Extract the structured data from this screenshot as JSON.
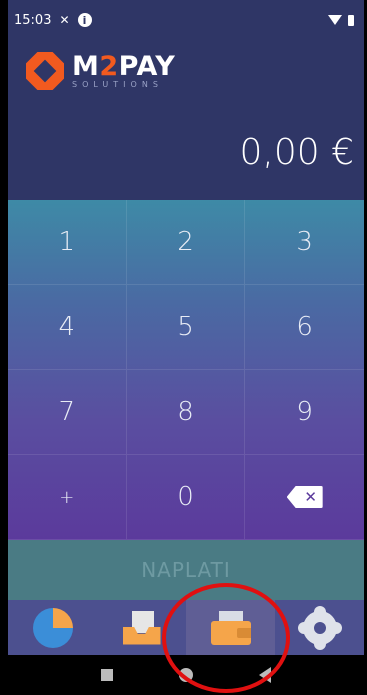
{
  "status": {
    "time": "15:03",
    "info_icon": "info-icon",
    "wifi_icon": "wifi-icon",
    "battery_icon": "battery-icon",
    "notification_icon": "missed-call-icon"
  },
  "brand": {
    "name_pre": "M",
    "name_num": "2",
    "name_post": "PAY",
    "tagline": "SOLUTIONS",
    "accent_color": "#f25a1f"
  },
  "amount": {
    "value": "0,00 €"
  },
  "keypad": {
    "keys": [
      "1",
      "2",
      "3",
      "4",
      "5",
      "6",
      "7",
      "8",
      "9",
      "+",
      "0"
    ],
    "backspace_icon": "backspace-icon"
  },
  "pay_button": {
    "label": "NAPLATI"
  },
  "tabbar": {
    "items": [
      {
        "name": "stats",
        "icon": "pie-chart-icon",
        "active": false
      },
      {
        "name": "inbox",
        "icon": "inbox-icon",
        "active": false
      },
      {
        "name": "wallet",
        "icon": "wallet-icon",
        "active": true
      },
      {
        "name": "settings",
        "icon": "gear-icon",
        "active": false
      }
    ]
  },
  "system_nav": {
    "icons": [
      "recents-icon",
      "home-icon",
      "back-icon"
    ]
  },
  "annotation": {
    "color": "#e01010",
    "target": "wallet"
  }
}
